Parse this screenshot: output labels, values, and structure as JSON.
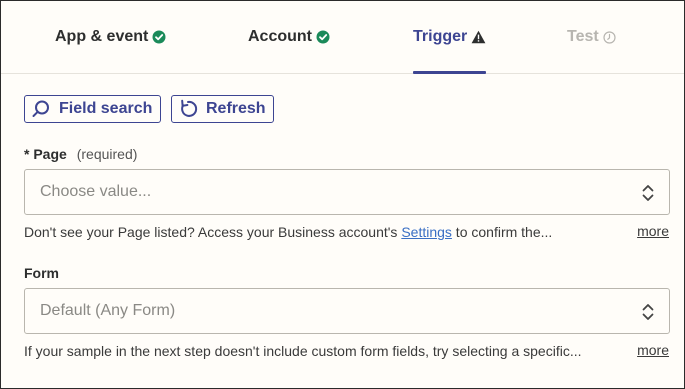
{
  "tabs": [
    {
      "label": "App & event",
      "status": "complete",
      "icon": "check-circle-icon"
    },
    {
      "label": "Account",
      "status": "complete",
      "icon": "check-circle-icon"
    },
    {
      "label": "Trigger",
      "status": "warning",
      "icon": "warning-triangle-icon"
    },
    {
      "label": "Test",
      "status": "disabled",
      "icon": "clock-icon"
    }
  ],
  "toolbar": {
    "field_search_label": "Field search",
    "refresh_label": "Refresh"
  },
  "page_field": {
    "required_marker": "*",
    "label": "Page",
    "required_text": "(required)",
    "placeholder": "Choose value...",
    "help_prefix": "Don't see your Page listed? Access your Business account's ",
    "help_link": "Settings",
    "help_suffix": " to confirm the...",
    "more_label": "more"
  },
  "form_field": {
    "label": "Form",
    "value": "Default (Any Form)",
    "help": "If your sample in the next step doesn't include custom form fields, try selecting a specific...",
    "more_label": "more"
  },
  "colors": {
    "accent": "#3d4592",
    "success": "#1b8a5a",
    "disabled": "#b7b5b0",
    "link": "#3a6fc4"
  }
}
